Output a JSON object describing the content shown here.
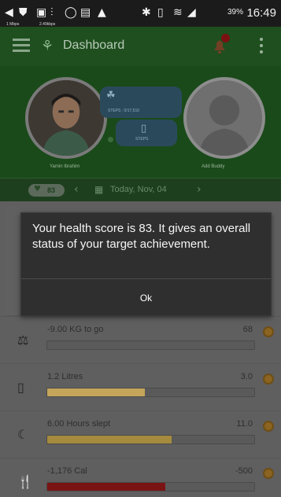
{
  "status_bar": {
    "left_icons": [
      "back-icon",
      "shield-icon",
      "image-icon",
      "signal-icon",
      "whatsapp-icon",
      "message-icon",
      "warning-icon"
    ],
    "right_icons": [
      "bluetooth-icon",
      "vibrate-icon",
      "wifi-icon",
      "cell-signal-icon"
    ],
    "battery": "39%",
    "time": "16:49",
    "carrier_1": "1 Mbps",
    "carrier_2": "2.49kbps"
  },
  "app_bar": {
    "title": "Dashboard",
    "notification_count": "1"
  },
  "profile": {
    "user_name": "Yamin Ibrahim",
    "buddy_name": "Add Buddy",
    "steps_text": "STEPS : 0/17,510",
    "steps_text_2": "STEPS"
  },
  "date_bar": {
    "health_score": "83",
    "date_label": "Today, Nov, 04"
  },
  "metrics": [
    {
      "icon": "weight-icon",
      "label": "-9.00 KG to go",
      "value": "68",
      "progress": 0.0,
      "fill_color": "#c4a55a"
    },
    {
      "icon": "water-icon",
      "label": "1.2 Litres",
      "value": "3.0",
      "progress": 0.47,
      "fill_color": "#c4a55a"
    },
    {
      "icon": "sleep-icon",
      "label": "6.00 Hours slept",
      "value": "11.0",
      "progress": 0.6,
      "fill_color": "#a68a3e"
    },
    {
      "icon": "food-icon",
      "label": "-1,176 Cal",
      "value": "-500",
      "progress": 0.57,
      "fill_color": "#7a1414"
    }
  ],
  "dialog": {
    "message": "Your health score is 83. It gives an overall status of your target achievement.",
    "ok_label": "Ok"
  },
  "colors": {
    "app_green": "#1f4f1f",
    "dialog_bg": "#2f2f2f"
  }
}
